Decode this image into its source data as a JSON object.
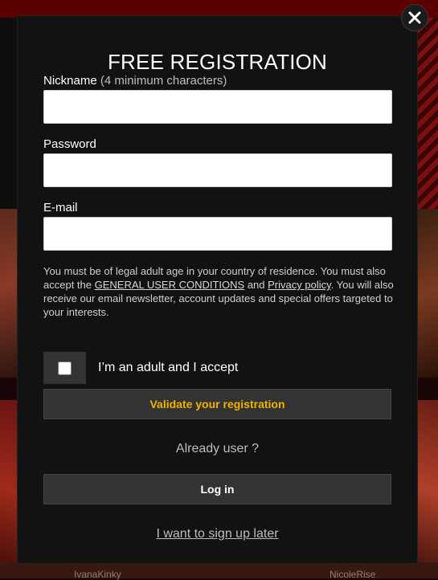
{
  "background": {
    "name_left": "IvanaKinky",
    "name_right": "NicoleRise"
  },
  "modal": {
    "title": "FREE REGISTRATION",
    "close_icon": "close-icon",
    "nickname": {
      "label": "Nickname",
      "hint": "(4 minimum characters)",
      "value": "",
      "placeholder": ""
    },
    "password": {
      "label": "Password",
      "value": "",
      "placeholder": ""
    },
    "email": {
      "label": "E-mail",
      "value": "",
      "placeholder": ""
    },
    "legal": {
      "text_1": "You must be of legal adult age in your country of residence. You must also accept the ",
      "link_conditions": "GENERAL USER CONDITIONS",
      "text_2": " and ",
      "link_privacy": "Privacy policy",
      "text_3": ". You will also receive our email newsletter, account updates and special offers targeted to your interests."
    },
    "accept_checkbox": {
      "label": "I’m an adult and I accept",
      "checked": false
    },
    "validate_button": "Validate your registration",
    "already_user": "Already user ?",
    "login_button": "Log in",
    "later_link": "I want to sign up later",
    "colors": {
      "accent": "#f0b400",
      "modal_bg": "#121212",
      "button_bg": "#333333"
    }
  }
}
